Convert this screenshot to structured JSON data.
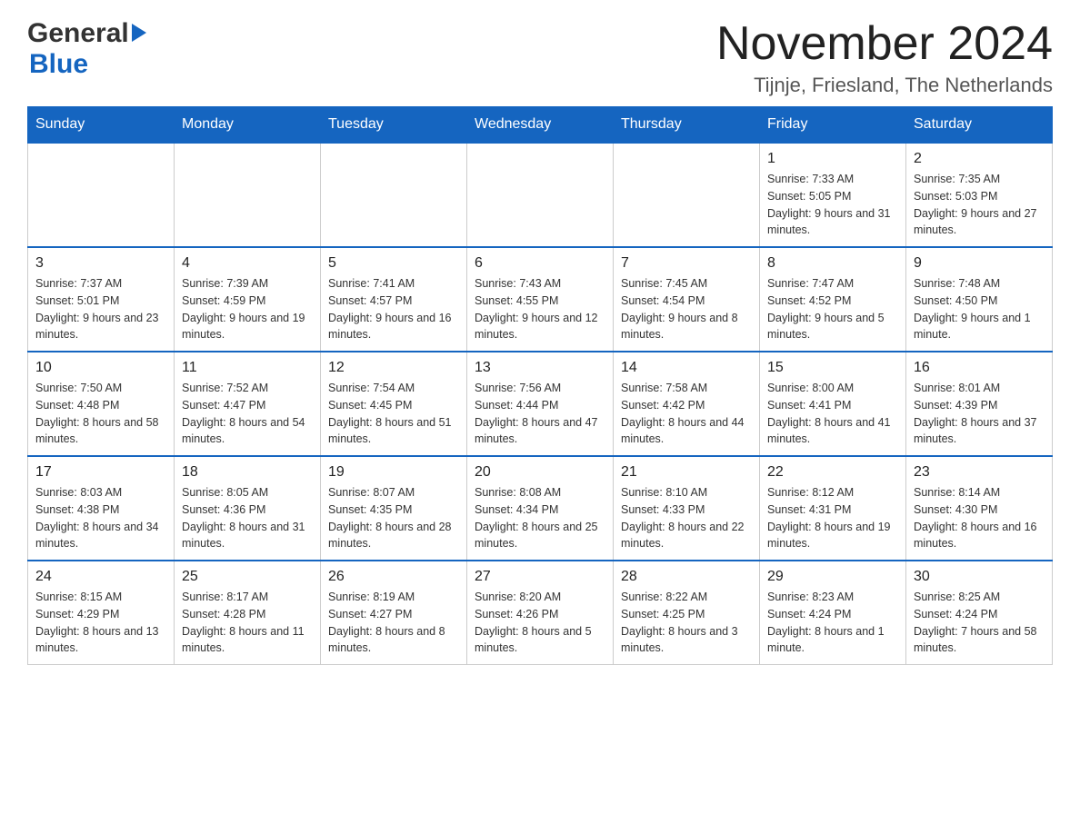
{
  "header": {
    "logo_general": "General",
    "logo_blue": "Blue",
    "month_title": "November 2024",
    "location": "Tijnje, Friesland, The Netherlands"
  },
  "calendar": {
    "days_of_week": [
      "Sunday",
      "Monday",
      "Tuesday",
      "Wednesday",
      "Thursday",
      "Friday",
      "Saturday"
    ],
    "weeks": [
      [
        {
          "day": "",
          "info": ""
        },
        {
          "day": "",
          "info": ""
        },
        {
          "day": "",
          "info": ""
        },
        {
          "day": "",
          "info": ""
        },
        {
          "day": "",
          "info": ""
        },
        {
          "day": "1",
          "info": "Sunrise: 7:33 AM\nSunset: 5:05 PM\nDaylight: 9 hours and 31 minutes."
        },
        {
          "day": "2",
          "info": "Sunrise: 7:35 AM\nSunset: 5:03 PM\nDaylight: 9 hours and 27 minutes."
        }
      ],
      [
        {
          "day": "3",
          "info": "Sunrise: 7:37 AM\nSunset: 5:01 PM\nDaylight: 9 hours and 23 minutes."
        },
        {
          "day": "4",
          "info": "Sunrise: 7:39 AM\nSunset: 4:59 PM\nDaylight: 9 hours and 19 minutes."
        },
        {
          "day": "5",
          "info": "Sunrise: 7:41 AM\nSunset: 4:57 PM\nDaylight: 9 hours and 16 minutes."
        },
        {
          "day": "6",
          "info": "Sunrise: 7:43 AM\nSunset: 4:55 PM\nDaylight: 9 hours and 12 minutes."
        },
        {
          "day": "7",
          "info": "Sunrise: 7:45 AM\nSunset: 4:54 PM\nDaylight: 9 hours and 8 minutes."
        },
        {
          "day": "8",
          "info": "Sunrise: 7:47 AM\nSunset: 4:52 PM\nDaylight: 9 hours and 5 minutes."
        },
        {
          "day": "9",
          "info": "Sunrise: 7:48 AM\nSunset: 4:50 PM\nDaylight: 9 hours and 1 minute."
        }
      ],
      [
        {
          "day": "10",
          "info": "Sunrise: 7:50 AM\nSunset: 4:48 PM\nDaylight: 8 hours and 58 minutes."
        },
        {
          "day": "11",
          "info": "Sunrise: 7:52 AM\nSunset: 4:47 PM\nDaylight: 8 hours and 54 minutes."
        },
        {
          "day": "12",
          "info": "Sunrise: 7:54 AM\nSunset: 4:45 PM\nDaylight: 8 hours and 51 minutes."
        },
        {
          "day": "13",
          "info": "Sunrise: 7:56 AM\nSunset: 4:44 PM\nDaylight: 8 hours and 47 minutes."
        },
        {
          "day": "14",
          "info": "Sunrise: 7:58 AM\nSunset: 4:42 PM\nDaylight: 8 hours and 44 minutes."
        },
        {
          "day": "15",
          "info": "Sunrise: 8:00 AM\nSunset: 4:41 PM\nDaylight: 8 hours and 41 minutes."
        },
        {
          "day": "16",
          "info": "Sunrise: 8:01 AM\nSunset: 4:39 PM\nDaylight: 8 hours and 37 minutes."
        }
      ],
      [
        {
          "day": "17",
          "info": "Sunrise: 8:03 AM\nSunset: 4:38 PM\nDaylight: 8 hours and 34 minutes."
        },
        {
          "day": "18",
          "info": "Sunrise: 8:05 AM\nSunset: 4:36 PM\nDaylight: 8 hours and 31 minutes."
        },
        {
          "day": "19",
          "info": "Sunrise: 8:07 AM\nSunset: 4:35 PM\nDaylight: 8 hours and 28 minutes."
        },
        {
          "day": "20",
          "info": "Sunrise: 8:08 AM\nSunset: 4:34 PM\nDaylight: 8 hours and 25 minutes."
        },
        {
          "day": "21",
          "info": "Sunrise: 8:10 AM\nSunset: 4:33 PM\nDaylight: 8 hours and 22 minutes."
        },
        {
          "day": "22",
          "info": "Sunrise: 8:12 AM\nSunset: 4:31 PM\nDaylight: 8 hours and 19 minutes."
        },
        {
          "day": "23",
          "info": "Sunrise: 8:14 AM\nSunset: 4:30 PM\nDaylight: 8 hours and 16 minutes."
        }
      ],
      [
        {
          "day": "24",
          "info": "Sunrise: 8:15 AM\nSunset: 4:29 PM\nDaylight: 8 hours and 13 minutes."
        },
        {
          "day": "25",
          "info": "Sunrise: 8:17 AM\nSunset: 4:28 PM\nDaylight: 8 hours and 11 minutes."
        },
        {
          "day": "26",
          "info": "Sunrise: 8:19 AM\nSunset: 4:27 PM\nDaylight: 8 hours and 8 minutes."
        },
        {
          "day": "27",
          "info": "Sunrise: 8:20 AM\nSunset: 4:26 PM\nDaylight: 8 hours and 5 minutes."
        },
        {
          "day": "28",
          "info": "Sunrise: 8:22 AM\nSunset: 4:25 PM\nDaylight: 8 hours and 3 minutes."
        },
        {
          "day": "29",
          "info": "Sunrise: 8:23 AM\nSunset: 4:24 PM\nDaylight: 8 hours and 1 minute."
        },
        {
          "day": "30",
          "info": "Sunrise: 8:25 AM\nSunset: 4:24 PM\nDaylight: 7 hours and 58 minutes."
        }
      ]
    ]
  }
}
